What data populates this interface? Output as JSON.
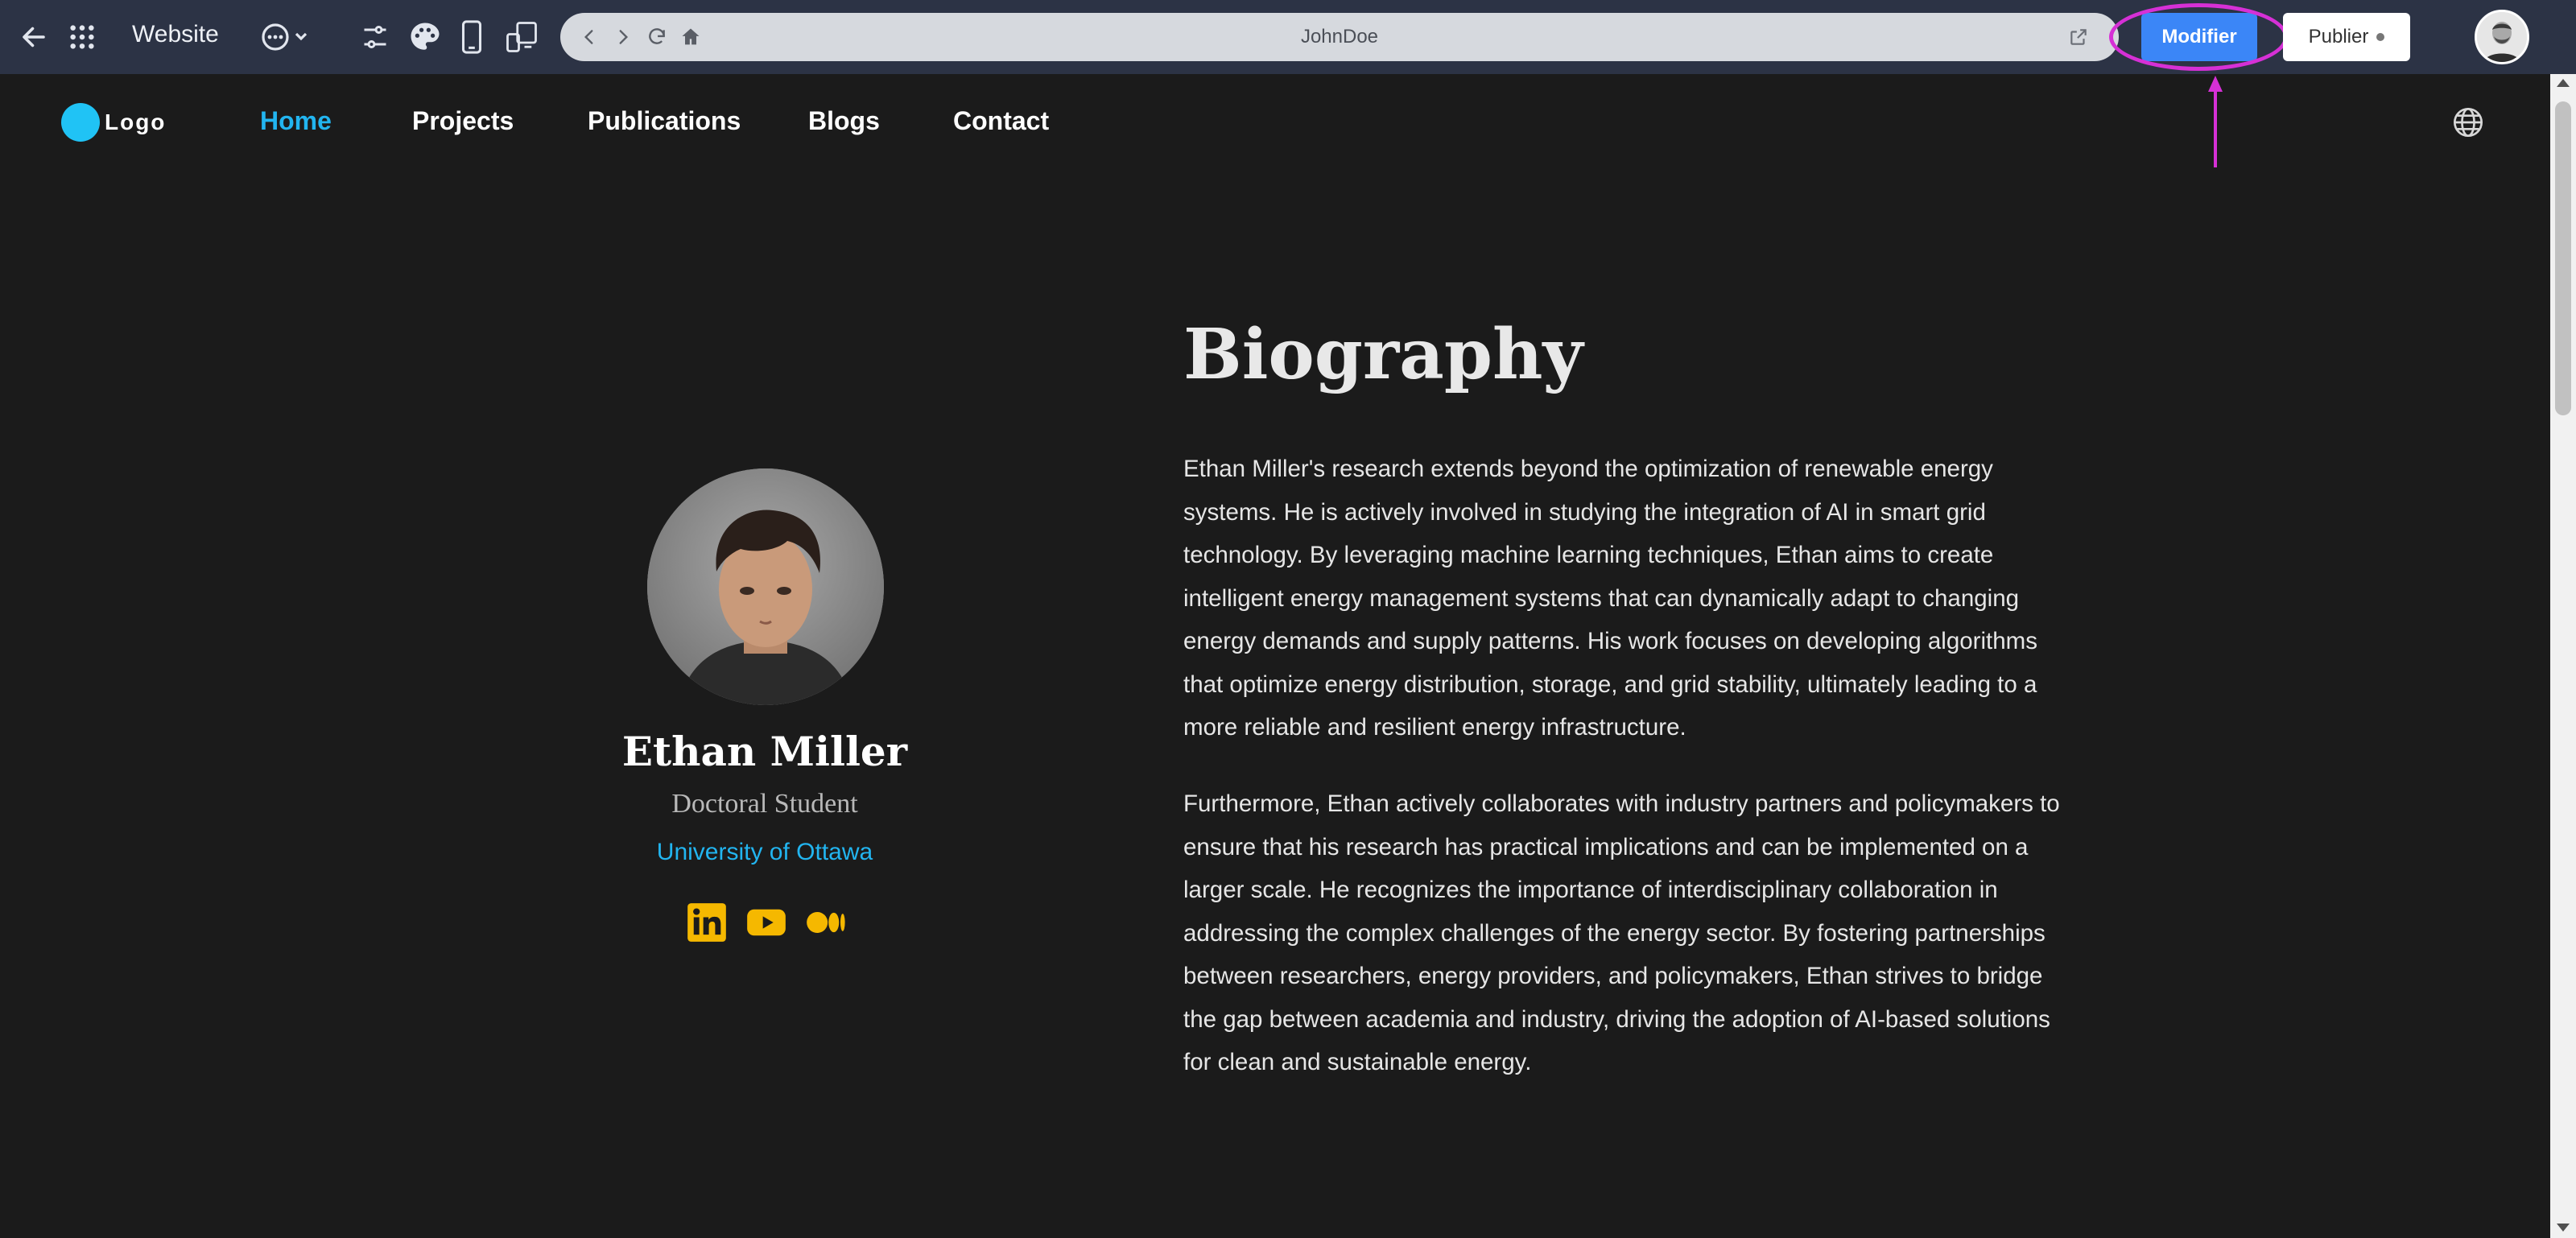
{
  "toolbar": {
    "title": "Website",
    "url": "JohnDoe",
    "modifier_label": "Modifier",
    "publier_label": "Publier"
  },
  "icons": {
    "back": "arrow-left-icon",
    "apps": "grid-icon",
    "more": "ellipsis-circle-icon",
    "settings": "sliders-icon",
    "theme": "palette-icon",
    "device": "mobile-icon",
    "responsive": "devices-icon",
    "open_external": "external-link-icon",
    "language": "globe-icon"
  },
  "site": {
    "logo_text": "Logo",
    "nav": [
      {
        "label": "Home",
        "active": true
      },
      {
        "label": "Projects",
        "active": false
      },
      {
        "label": "Publications",
        "active": false
      },
      {
        "label": "Blogs",
        "active": false
      },
      {
        "label": "Contact",
        "active": false
      }
    ]
  },
  "profile": {
    "name": "Ethan Miller",
    "role": "Doctoral Student",
    "university": "University of Ottawa",
    "social": [
      "linkedin-icon",
      "youtube-icon",
      "medium-icon"
    ]
  },
  "biography": {
    "title": "Biography",
    "paragraphs": [
      "Ethan Miller's research extends beyond the optimization of renewable energy systems. He is actively involved in studying the integration of AI in smart grid technology. By leveraging machine learning techniques, Ethan aims to create intelligent energy management systems that can dynamically adapt to changing energy demands and supply patterns. His work focuses on developing algorithms that optimize energy distribution, storage, and grid stability, ultimately leading to a more reliable and resilient energy infrastructure.",
      "Furthermore, Ethan actively collaborates with industry partners and policymakers to ensure that his research has practical implications and can be implemented on a larger scale. He recognizes the importance of interdisciplinary collaboration in addressing the complex challenges of the energy sector. By fostering partnerships between researchers, energy providers, and policymakers, Ethan strives to bridge the gap between academia and industry, driving the adoption of AI-based solutions for clean and sustainable energy."
    ]
  },
  "colors": {
    "toolbar_bg": "#2c3345",
    "page_bg": "#1b1b1b",
    "accent_blue": "#22b5f0",
    "button_blue": "#3b86f7",
    "social_yellow": "#f5b800",
    "annotation_magenta": "#d630d6"
  }
}
